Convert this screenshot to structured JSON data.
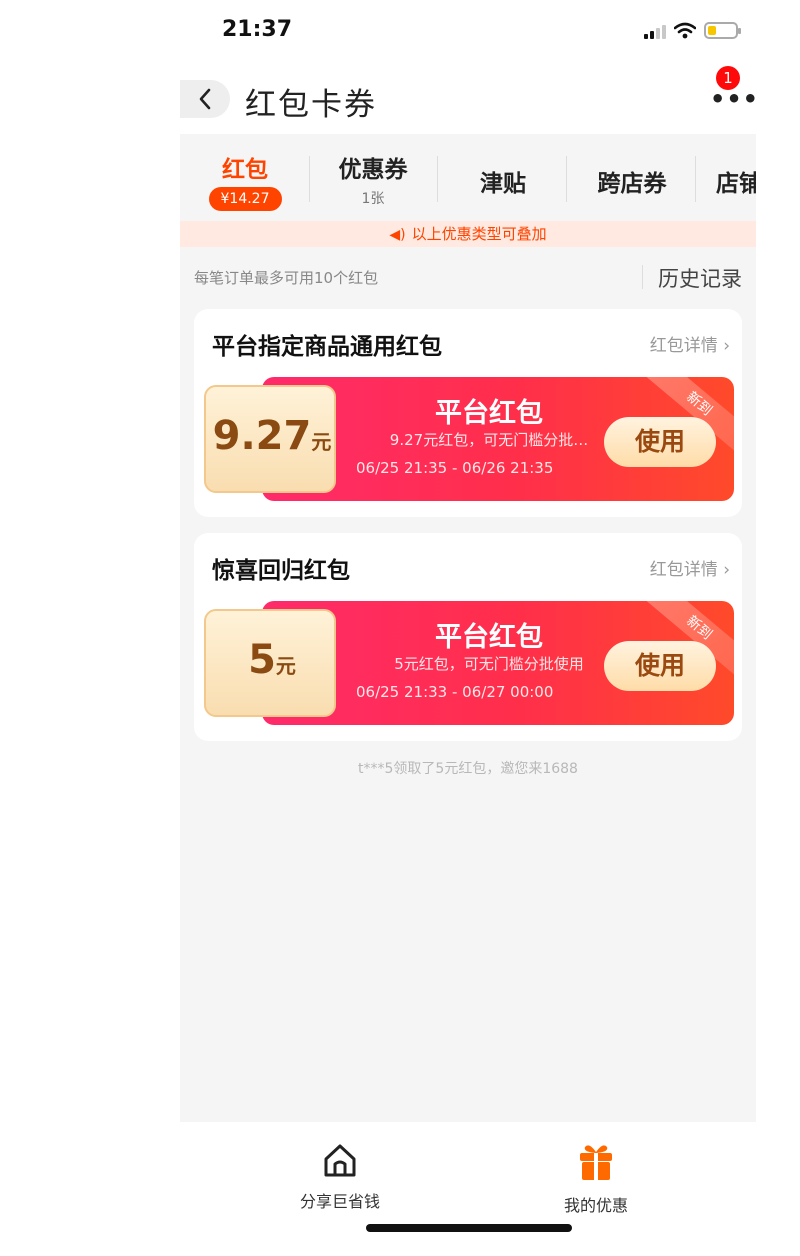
{
  "status_bar": {
    "time": "21:37"
  },
  "header": {
    "title": "红包卡券",
    "badge_count": "1"
  },
  "tabs": [
    {
      "label": "红包",
      "sub": "¥14.27",
      "active": true
    },
    {
      "label": "优惠券",
      "sub": "1张"
    },
    {
      "label": "津贴"
    },
    {
      "label": "跨店券"
    },
    {
      "label": "店铺"
    }
  ],
  "notice": {
    "text": "以上优惠类型可叠加"
  },
  "info": {
    "limit_text": "每笔订单最多可用10个红包",
    "history_label": "历史记录"
  },
  "cards": [
    {
      "title": "平台指定商品通用红包",
      "detail_label": "红包详情",
      "coupon": {
        "amount": "9.27",
        "unit": "元",
        "name": "平台红包",
        "desc": "9.27元红包，可无门槛分批…",
        "time": "06/25 21:35 - 06/26 21:35",
        "tag": "新到",
        "button": "使用"
      }
    },
    {
      "title": "惊喜回归红包",
      "detail_label": "红包详情",
      "coupon": {
        "amount": "5",
        "unit": "元",
        "name": "平台红包",
        "desc": "5元红包，可无门槛分批使用",
        "time": "06/25 21:33 - 06/27 00:00",
        "tag": "新到",
        "button": "使用"
      }
    }
  ],
  "footer_note": "t***5领取了5元红包，邀您来1688",
  "bottom_nav": [
    {
      "label": "分享巨省钱",
      "icon": "home-icon"
    },
    {
      "label": "我的优惠",
      "icon": "gift-icon"
    }
  ],
  "colors": {
    "accent": "#ff4400",
    "coupon_red": "#ff2f4a",
    "gold": "#f9ddb0"
  }
}
